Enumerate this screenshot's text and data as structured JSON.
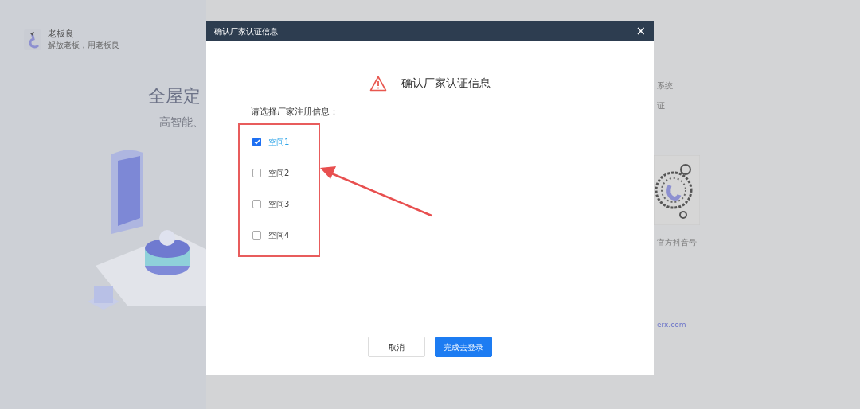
{
  "background": {
    "brand": {
      "name": "老板良",
      "slogan": "解放老板，用老板良"
    },
    "hero": {
      "title": "全屋定",
      "subtitle": "高智能、"
    },
    "side": {
      "title": "系统",
      "subtitle": "证",
      "qr_caption": "官方抖音号",
      "link": "erx.com"
    }
  },
  "dialog": {
    "title": "确认厂家认证信息",
    "close": "×",
    "heading": "确认厂家认证信息",
    "prompt": "请选择厂家注册信息：",
    "options": [
      {
        "label": "空间1",
        "checked": true
      },
      {
        "label": "空间2",
        "checked": false
      },
      {
        "label": "空间3",
        "checked": false
      },
      {
        "label": "空间4",
        "checked": false
      }
    ],
    "buttons": [
      {
        "label": "取消",
        "kind": "secondary"
      },
      {
        "label": "完成去登录",
        "kind": "primary"
      }
    ]
  }
}
